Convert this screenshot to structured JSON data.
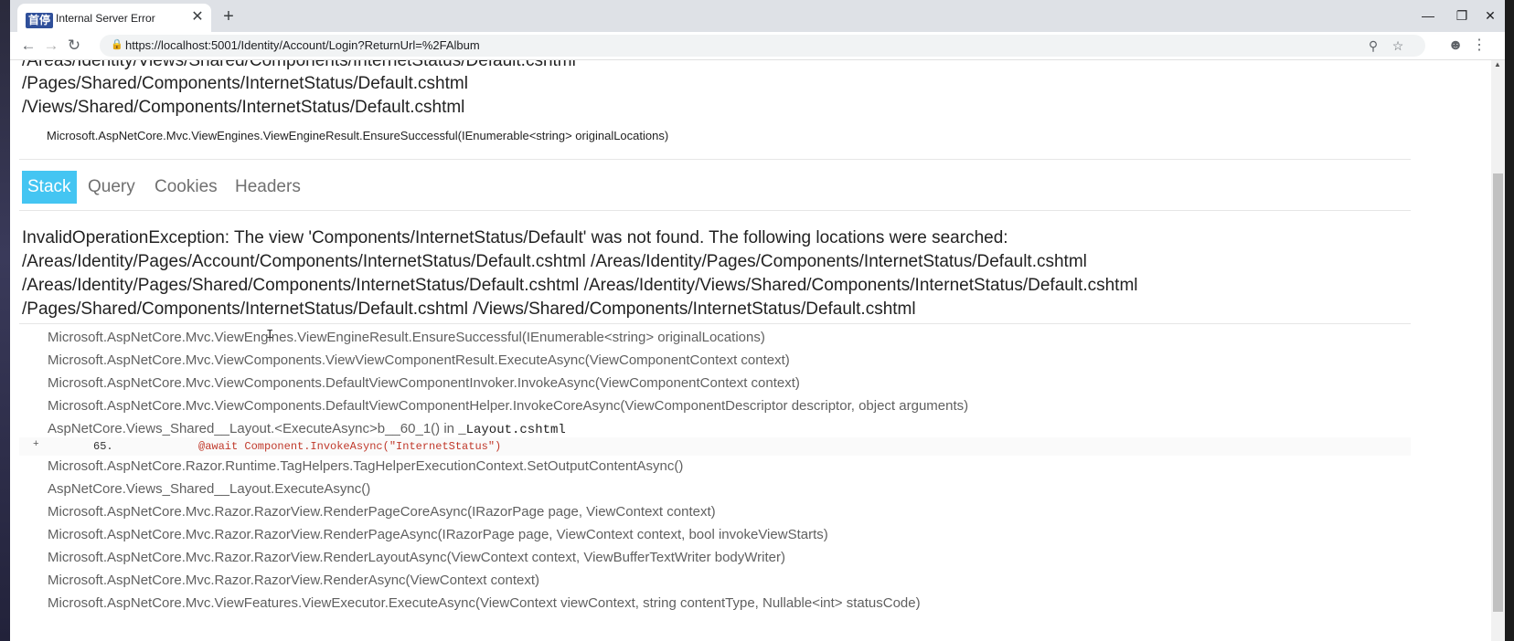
{
  "browser": {
    "tab_badge": "首停",
    "tab_title": "Internal Server Error",
    "tab_close": "✕",
    "new_tab": "+",
    "url": "https://localhost:5001/Identity/Account/Login?ReturnUrl=%2FAlbum",
    "icons": {
      "back": "arrow-left-icon",
      "forward": "arrow-right-icon",
      "reload": "reload-icon",
      "lock": "lock-icon",
      "zoom": "zoom-icon",
      "star": "star-icon",
      "profile": "profile-icon",
      "menu": "kebab-menu-icon",
      "minimize": "minimize-icon",
      "restore": "restore-icon",
      "close": "close-icon"
    }
  },
  "error_page": {
    "searched_locations_top": [
      "/Areas/Identity/Views/Shared/Components/InternetStatus/Default.cshtml",
      "/Pages/Shared/Components/InternetStatus/Default.cshtml",
      "/Views/Shared/Components/InternetStatus/Default.cshtml"
    ],
    "top_method": "Microsoft.AspNetCore.Mvc.ViewEngines.ViewEngineResult.EnsureSuccessful(IEnumerable<string> originalLocations)",
    "tabs": [
      "Stack",
      "Query",
      "Cookies",
      "Headers"
    ],
    "active_tab": "Stack",
    "exception_lines": [
      "InvalidOperationException: The view 'Components/InternetStatus/Default' was not found. The following locations were searched:",
      "/Areas/Identity/Pages/Account/Components/InternetStatus/Default.cshtml /Areas/Identity/Pages/Components/InternetStatus/Default.cshtml",
      "/Areas/Identity/Pages/Shared/Components/InternetStatus/Default.cshtml /Areas/Identity/Views/Shared/Components/InternetStatus/Default.cshtml",
      "/Pages/Shared/Components/InternetStatus/Default.cshtml /Views/Shared/Components/InternetStatus/Default.cshtml"
    ],
    "frames_before_code": [
      "Microsoft.AspNetCore.Mvc.ViewEngines.ViewEngineResult.EnsureSuccessful(IEnumerable<string> originalLocations)",
      "Microsoft.AspNetCore.Mvc.ViewComponents.ViewViewComponentResult.ExecuteAsync(ViewComponentContext context)",
      "Microsoft.AspNetCore.Mvc.ViewComponents.DefaultViewComponentInvoker.InvokeAsync(ViewComponentContext context)",
      "Microsoft.AspNetCore.Mvc.ViewComponents.DefaultViewComponentHelper.InvokeCoreAsync(ViewComponentDescriptor descriptor, object arguments)"
    ],
    "layout_frame": {
      "method": "AspNetCore.Views_Shared__Layout.<ExecuteAsync>b__60_1() in ",
      "file": "_Layout.cshtml"
    },
    "code_snippet": {
      "expander": "+",
      "line_number": "65.",
      "code": "@await Component.InvokeAsync(\"InternetStatus\")"
    },
    "frames_after_code": [
      "Microsoft.AspNetCore.Razor.Runtime.TagHelpers.TagHelperExecutionContext.SetOutputContentAsync()",
      "AspNetCore.Views_Shared__Layout.ExecuteAsync()",
      "Microsoft.AspNetCore.Mvc.Razor.RazorView.RenderPageCoreAsync(IRazorPage page, ViewContext context)",
      "Microsoft.AspNetCore.Mvc.Razor.RazorView.RenderPageAsync(IRazorPage page, ViewContext context, bool invokeViewStarts)",
      "Microsoft.AspNetCore.Mvc.Razor.RazorView.RenderLayoutAsync(ViewContext context, ViewBufferTextWriter bodyWriter)",
      "Microsoft.AspNetCore.Mvc.Razor.RazorView.RenderAsync(ViewContext context)",
      "Microsoft.AspNetCore.Mvc.ViewFeatures.ViewExecutor.ExecuteAsync(ViewContext viewContext, string contentType, Nullable<int> statusCode)"
    ]
  }
}
